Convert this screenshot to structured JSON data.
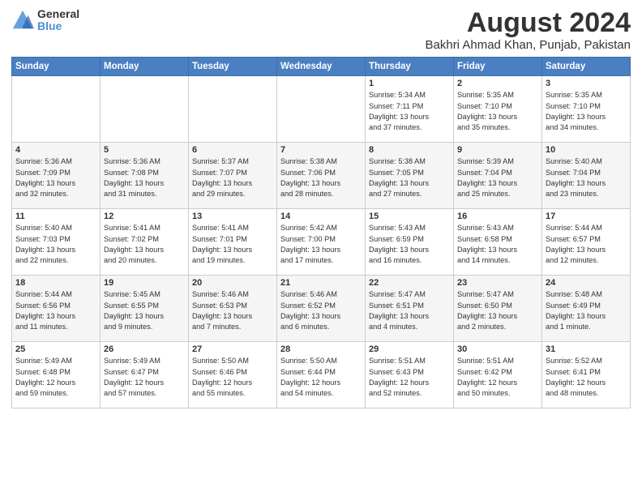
{
  "header": {
    "logo_general": "General",
    "logo_blue": "Blue",
    "main_title": "August 2024",
    "subtitle": "Bakhri Ahmad Khan, Punjab, Pakistan"
  },
  "calendar": {
    "days_of_week": [
      "Sunday",
      "Monday",
      "Tuesday",
      "Wednesday",
      "Thursday",
      "Friday",
      "Saturday"
    ],
    "weeks": [
      [
        {
          "day": "",
          "info": ""
        },
        {
          "day": "",
          "info": ""
        },
        {
          "day": "",
          "info": ""
        },
        {
          "day": "",
          "info": ""
        },
        {
          "day": "1",
          "info": "Sunrise: 5:34 AM\nSunset: 7:11 PM\nDaylight: 13 hours\nand 37 minutes."
        },
        {
          "day": "2",
          "info": "Sunrise: 5:35 AM\nSunset: 7:10 PM\nDaylight: 13 hours\nand 35 minutes."
        },
        {
          "day": "3",
          "info": "Sunrise: 5:35 AM\nSunset: 7:10 PM\nDaylight: 13 hours\nand 34 minutes."
        }
      ],
      [
        {
          "day": "4",
          "info": "Sunrise: 5:36 AM\nSunset: 7:09 PM\nDaylight: 13 hours\nand 32 minutes."
        },
        {
          "day": "5",
          "info": "Sunrise: 5:36 AM\nSunset: 7:08 PM\nDaylight: 13 hours\nand 31 minutes."
        },
        {
          "day": "6",
          "info": "Sunrise: 5:37 AM\nSunset: 7:07 PM\nDaylight: 13 hours\nand 29 minutes."
        },
        {
          "day": "7",
          "info": "Sunrise: 5:38 AM\nSunset: 7:06 PM\nDaylight: 13 hours\nand 28 minutes."
        },
        {
          "day": "8",
          "info": "Sunrise: 5:38 AM\nSunset: 7:05 PM\nDaylight: 13 hours\nand 27 minutes."
        },
        {
          "day": "9",
          "info": "Sunrise: 5:39 AM\nSunset: 7:04 PM\nDaylight: 13 hours\nand 25 minutes."
        },
        {
          "day": "10",
          "info": "Sunrise: 5:40 AM\nSunset: 7:04 PM\nDaylight: 13 hours\nand 23 minutes."
        }
      ],
      [
        {
          "day": "11",
          "info": "Sunrise: 5:40 AM\nSunset: 7:03 PM\nDaylight: 13 hours\nand 22 minutes."
        },
        {
          "day": "12",
          "info": "Sunrise: 5:41 AM\nSunset: 7:02 PM\nDaylight: 13 hours\nand 20 minutes."
        },
        {
          "day": "13",
          "info": "Sunrise: 5:41 AM\nSunset: 7:01 PM\nDaylight: 13 hours\nand 19 minutes."
        },
        {
          "day": "14",
          "info": "Sunrise: 5:42 AM\nSunset: 7:00 PM\nDaylight: 13 hours\nand 17 minutes."
        },
        {
          "day": "15",
          "info": "Sunrise: 5:43 AM\nSunset: 6:59 PM\nDaylight: 13 hours\nand 16 minutes."
        },
        {
          "day": "16",
          "info": "Sunrise: 5:43 AM\nSunset: 6:58 PM\nDaylight: 13 hours\nand 14 minutes."
        },
        {
          "day": "17",
          "info": "Sunrise: 5:44 AM\nSunset: 6:57 PM\nDaylight: 13 hours\nand 12 minutes."
        }
      ],
      [
        {
          "day": "18",
          "info": "Sunrise: 5:44 AM\nSunset: 6:56 PM\nDaylight: 13 hours\nand 11 minutes."
        },
        {
          "day": "19",
          "info": "Sunrise: 5:45 AM\nSunset: 6:55 PM\nDaylight: 13 hours\nand 9 minutes."
        },
        {
          "day": "20",
          "info": "Sunrise: 5:46 AM\nSunset: 6:53 PM\nDaylight: 13 hours\nand 7 minutes."
        },
        {
          "day": "21",
          "info": "Sunrise: 5:46 AM\nSunset: 6:52 PM\nDaylight: 13 hours\nand 6 minutes."
        },
        {
          "day": "22",
          "info": "Sunrise: 5:47 AM\nSunset: 6:51 PM\nDaylight: 13 hours\nand 4 minutes."
        },
        {
          "day": "23",
          "info": "Sunrise: 5:47 AM\nSunset: 6:50 PM\nDaylight: 13 hours\nand 2 minutes."
        },
        {
          "day": "24",
          "info": "Sunrise: 5:48 AM\nSunset: 6:49 PM\nDaylight: 13 hours\nand 1 minute."
        }
      ],
      [
        {
          "day": "25",
          "info": "Sunrise: 5:49 AM\nSunset: 6:48 PM\nDaylight: 12 hours\nand 59 minutes."
        },
        {
          "day": "26",
          "info": "Sunrise: 5:49 AM\nSunset: 6:47 PM\nDaylight: 12 hours\nand 57 minutes."
        },
        {
          "day": "27",
          "info": "Sunrise: 5:50 AM\nSunset: 6:46 PM\nDaylight: 12 hours\nand 55 minutes."
        },
        {
          "day": "28",
          "info": "Sunrise: 5:50 AM\nSunset: 6:44 PM\nDaylight: 12 hours\nand 54 minutes."
        },
        {
          "day": "29",
          "info": "Sunrise: 5:51 AM\nSunset: 6:43 PM\nDaylight: 12 hours\nand 52 minutes."
        },
        {
          "day": "30",
          "info": "Sunrise: 5:51 AM\nSunset: 6:42 PM\nDaylight: 12 hours\nand 50 minutes."
        },
        {
          "day": "31",
          "info": "Sunrise: 5:52 AM\nSunset: 6:41 PM\nDaylight: 12 hours\nand 48 minutes."
        }
      ]
    ]
  }
}
